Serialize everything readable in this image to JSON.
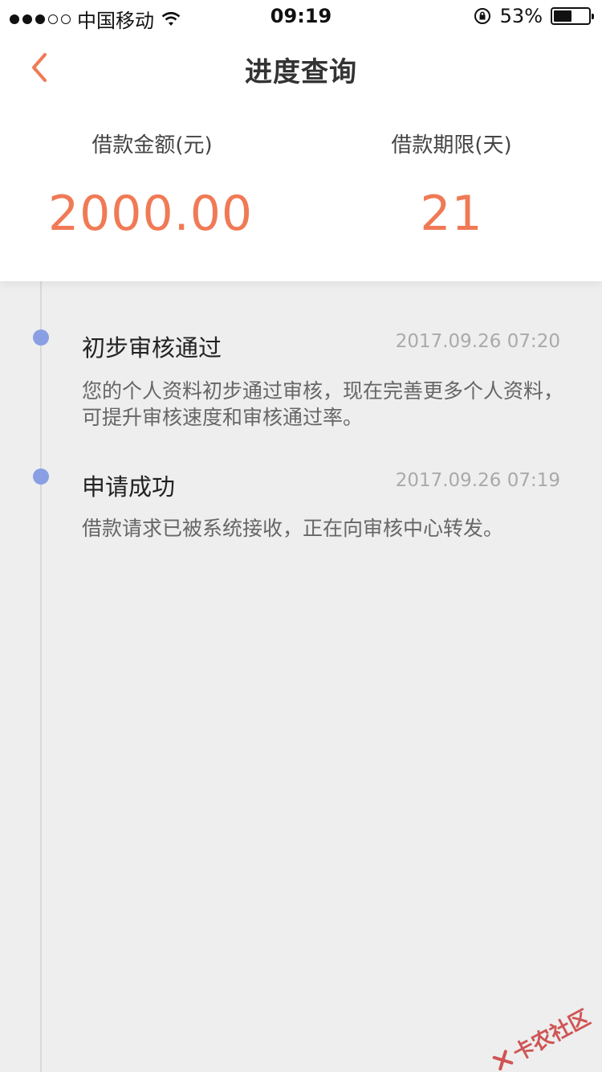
{
  "status_bar": {
    "carrier": "中国移动",
    "time": "09:19",
    "battery_percent": "53%",
    "battery_level": 0.53
  },
  "nav": {
    "title": "进度查询"
  },
  "summary": {
    "amount_label": "借款金额(元)",
    "amount_value": "2000.00",
    "term_label": "借款期限(天)",
    "term_value": "21"
  },
  "timeline": [
    {
      "title": "初步审核通过",
      "timestamp": "2017.09.26 07:20",
      "description": "您的个人资料初步通过审核，现在完善更多个人资料，可提升审核速度和审核通过率。"
    },
    {
      "title": "申请成功",
      "timestamp": "2017.09.26 07:19",
      "description": "借款请求已被系统接收，正在向审核中心转发。"
    }
  ],
  "watermark": {
    "text": "卡农社区"
  },
  "colors": {
    "accent": "#f07a55",
    "timeline_node": "#8a9fe3",
    "background": "#eeeeee"
  }
}
